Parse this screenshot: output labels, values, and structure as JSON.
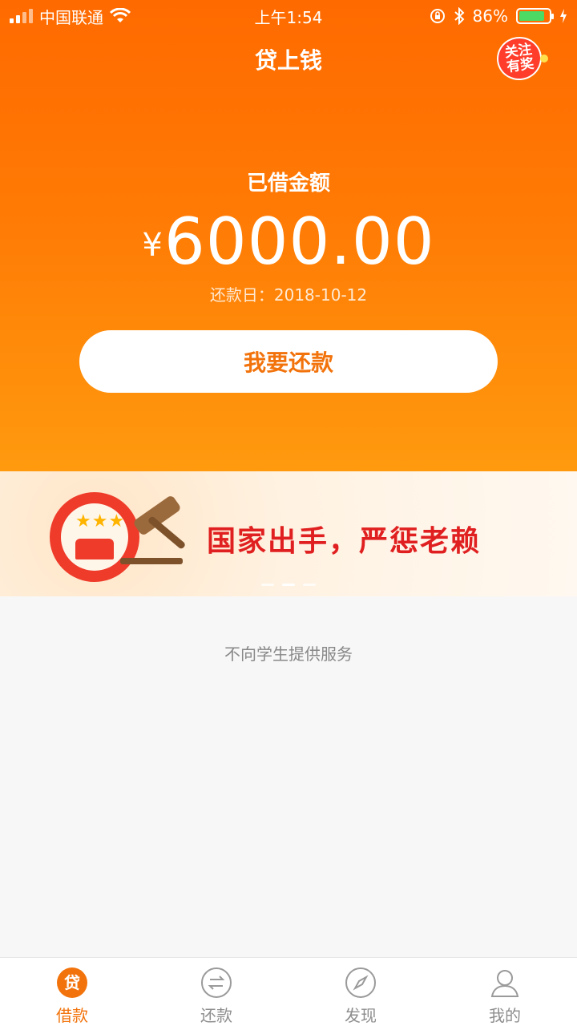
{
  "status_bar": {
    "carrier": "中国联通",
    "time": "上午1:54",
    "battery_percent": "86%",
    "battery_level": 0.86
  },
  "nav": {
    "title": "贷上钱",
    "promo_line1": "关注",
    "promo_line2": "有奖"
  },
  "loan": {
    "label": "已借金额",
    "currency_symbol": "¥",
    "amount": "6000.00",
    "due_date": "还款日：2018-10-12",
    "repay_button": "我要还款"
  },
  "banner": {
    "text": "国家出手，严惩老赖",
    "slide_count": 3,
    "active_slide": 1
  },
  "notice": "不向学生提供服务",
  "tabbar": {
    "items": [
      {
        "label": "借款",
        "icon": "loan-icon",
        "active": true
      },
      {
        "label": "还款",
        "icon": "repay-icon",
        "active": false
      },
      {
        "label": "发现",
        "icon": "compass-icon",
        "active": false
      },
      {
        "label": "我的",
        "icon": "user-icon",
        "active": false
      }
    ]
  },
  "colors": {
    "accent": "#f2730c",
    "hero_top": "#ff6a00",
    "hero_bottom": "#ff9a0e",
    "banner_red": "#e02020",
    "tab_inactive": "#8d8d8d"
  }
}
